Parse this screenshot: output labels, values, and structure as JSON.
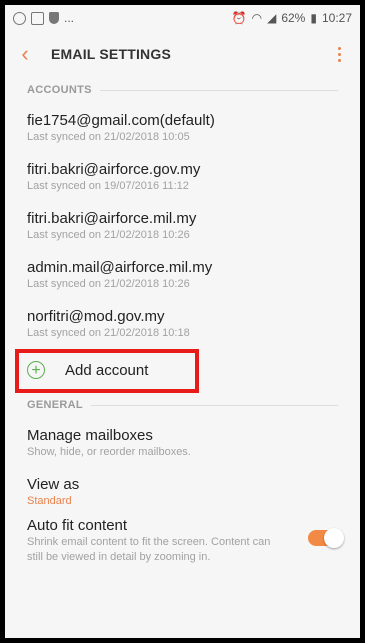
{
  "status_bar": {
    "time": "10:27",
    "battery": "62%",
    "left_ellipsis": "..."
  },
  "app_bar": {
    "title": "EMAIL SETTINGS"
  },
  "accounts_section": {
    "header": "ACCOUNTS",
    "items": [
      {
        "email": "fie1754@gmail.com(default)",
        "synced": "Last synced on 21/02/2018  10:05"
      },
      {
        "email": "fitri.bakri@airforce.gov.my",
        "synced": "Last synced on 19/07/2016  11:12"
      },
      {
        "email": "fitri.bakri@airforce.mil.my",
        "synced": "Last synced on 21/02/2018  10:26"
      },
      {
        "email": "admin.mail@airforce.mil.my",
        "synced": "Last synced on 21/02/2018  10:26"
      },
      {
        "email": "norfitri@mod.gov.my",
        "synced": "Last synced on 21/02/2018  10:18"
      }
    ],
    "add_account_label": "Add account"
  },
  "general_section": {
    "header": "GENERAL",
    "manage_mailboxes": {
      "title": "Manage mailboxes",
      "subtitle": "Show, hide, or reorder mailboxes."
    },
    "view_as": {
      "title": "View as",
      "value": "Standard"
    },
    "auto_fit": {
      "title": "Auto fit content",
      "subtitle": "Shrink email content to fit the screen. Content can still be viewed in detail by zooming in.",
      "enabled": true
    }
  },
  "colors": {
    "accent": "#e8834e",
    "highlight": "#e81b1b",
    "add_icon": "#5ab04f"
  }
}
